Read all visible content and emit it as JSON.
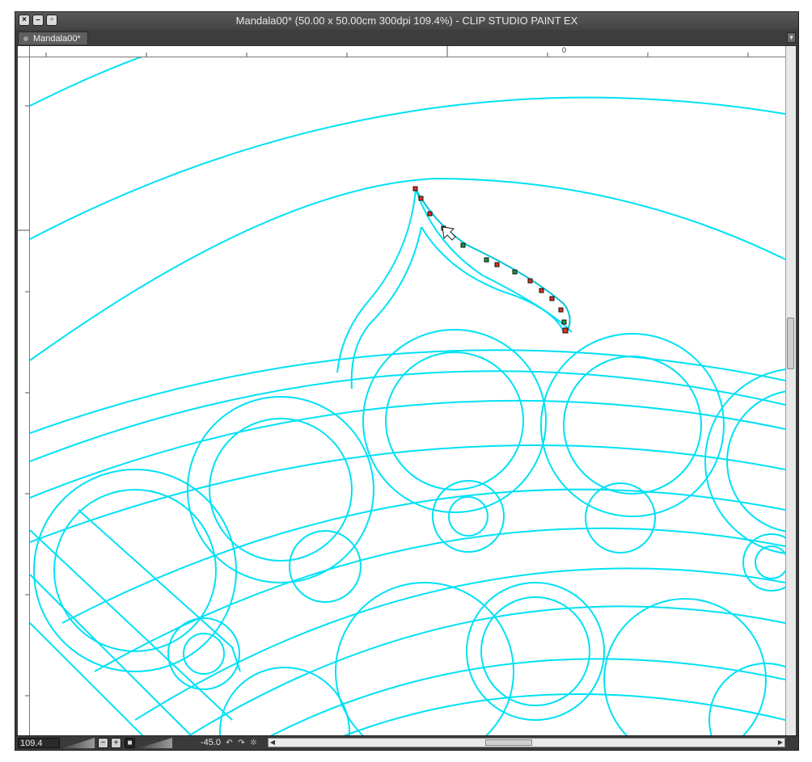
{
  "window": {
    "title": "Mandala00* (50.00 x 50.00cm 300dpi 109.4%)  - CLIP STUDIO PAINT EX",
    "controls": [
      "close-icon",
      "minimize-icon",
      "maximize-icon"
    ]
  },
  "tabs": [
    {
      "label": "Mandala00*",
      "active": true
    }
  ],
  "ruler": {
    "zero_label": "0"
  },
  "statusbar": {
    "zoom": "109.4",
    "angle": "-45.0"
  },
  "colors": {
    "guide_line": "#00e1f5",
    "control_point_red": "#e03020",
    "control_point_green": "#1a9a3a",
    "chrome_dark": "#3a3a3a"
  },
  "canvas": {
    "tool_cursor": "arrow-cursor-icon",
    "control_points_count": 14
  }
}
